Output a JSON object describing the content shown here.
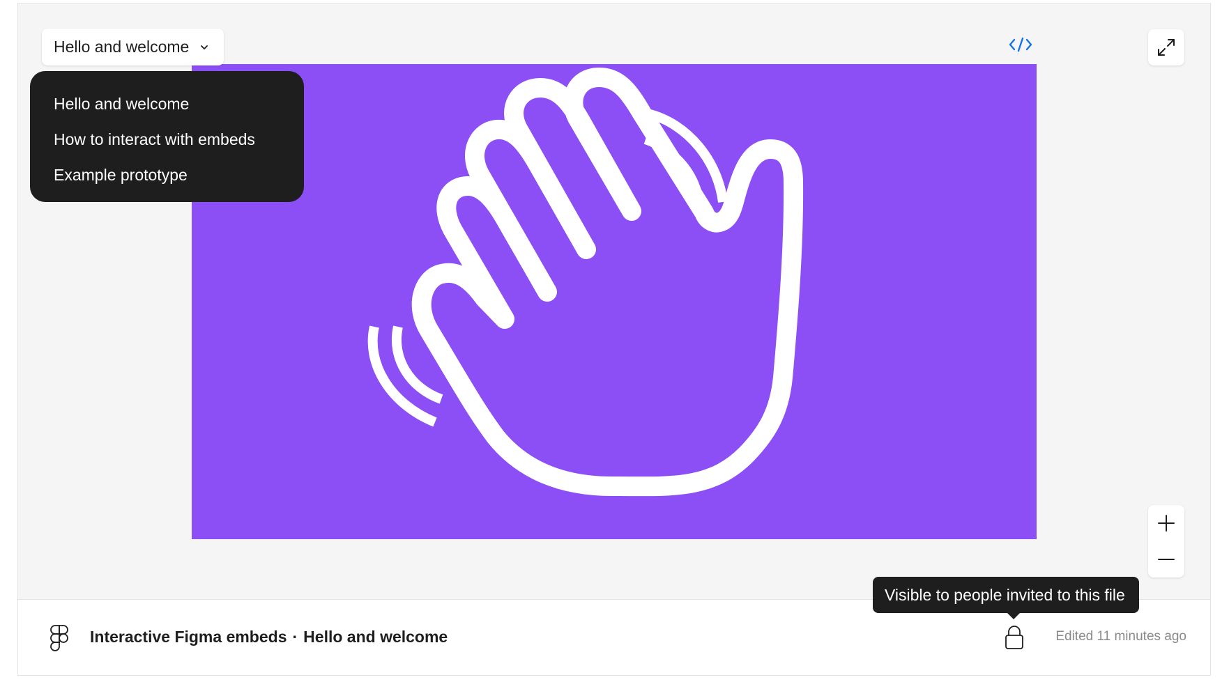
{
  "page_selector": {
    "selected_label": "Hello and welcome"
  },
  "page_menu": {
    "items": [
      {
        "label": "Hello and welcome"
      },
      {
        "label": "How to interact with embeds"
      },
      {
        "label": "Example prototype"
      }
    ]
  },
  "frame": {
    "background_color": "#8c4ef5",
    "illustration": "waving-hand-icon"
  },
  "controls": {
    "code_icon": "code-icon",
    "fullscreen_icon": "expand-icon",
    "zoom_in_icon": "plus-icon",
    "zoom_out_icon": "minus-icon"
  },
  "tooltip": {
    "text": "Visible to people invited to this file"
  },
  "footer": {
    "file_name": "Interactive Figma embeds",
    "separator": "·",
    "page_name": "Hello and welcome",
    "edited_text": "Edited 11 minutes ago"
  },
  "colors": {
    "accent": "#8c4ef5",
    "dark": "#1e1e1e",
    "code_link": "#0d99ff"
  }
}
